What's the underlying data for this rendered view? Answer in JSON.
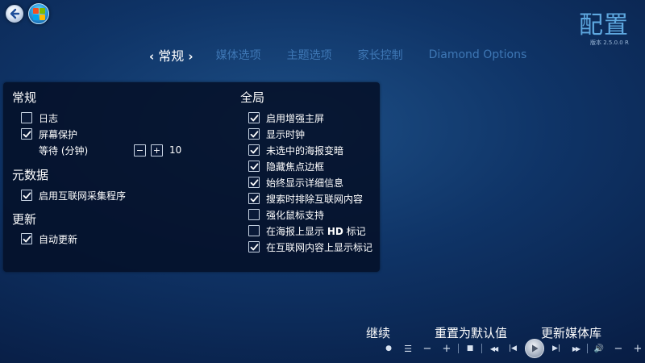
{
  "header": {
    "title": "配置",
    "version": "版本 2.5.0.0 R"
  },
  "tabs": [
    {
      "label": "常规",
      "active": true
    },
    {
      "label": "媒体选项",
      "active": false
    },
    {
      "label": "主题选项",
      "active": false
    },
    {
      "label": "家长控制",
      "active": false
    },
    {
      "label": "Diamond Options",
      "active": false
    }
  ],
  "left": {
    "general": {
      "title": "常规",
      "log": {
        "label": "日志",
        "checked": false
      },
      "screensaver": {
        "label": "屏幕保护",
        "checked": true
      },
      "wait": {
        "label": "等待 (分钟)",
        "minus": "−",
        "plus": "+",
        "value": "10"
      }
    },
    "metadata": {
      "title": "元数据",
      "internet_providers": {
        "label": "启用互联网采集程序",
        "checked": true
      }
    },
    "updates": {
      "title": "更新",
      "auto_update": {
        "label": "自动更新",
        "checked": true
      }
    }
  },
  "global": {
    "title": "全局",
    "items": [
      {
        "label": "启用增强主屏",
        "checked": true
      },
      {
        "label": "显示时钟",
        "checked": true
      },
      {
        "label": "未选中的海报变暗",
        "checked": true
      },
      {
        "label": "隐藏焦点边框",
        "checked": true
      },
      {
        "label": "始终显示详细信息",
        "checked": true
      },
      {
        "label": "搜索时排除互联网内容",
        "checked": true
      },
      {
        "label": "强化鼠标支持",
        "checked": false
      },
      {
        "label_pre": "在海报上显示 ",
        "label_bold": "HD",
        "label_post": " 标记",
        "checked": false
      },
      {
        "label": "在互联网内容上显示标记",
        "checked": true
      }
    ]
  },
  "commands": {
    "continue": "继续",
    "reset": "重置为默认值",
    "refresh": "更新媒体库"
  },
  "transport": {
    "record": "●",
    "guide": "☰",
    "channel_down": "−",
    "channel_up": "+",
    "stop": "■",
    "rewind": "◀◀",
    "prev": "|◀",
    "next": "▶|",
    "fast_forward": "▶▶",
    "mute": "🔊",
    "vol_down": "−",
    "vol_up": "+"
  },
  "colors": {
    "background": "#0f3467",
    "panel": "#05102a",
    "tab_inactive": "#3e77b5",
    "title": "#5ea8e0"
  }
}
